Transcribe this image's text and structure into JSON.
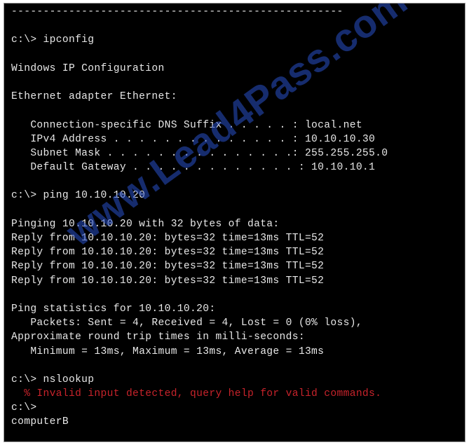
{
  "terminal": {
    "lines": [
      {
        "text": "----------------------------------------------------",
        "type": "normal"
      },
      {
        "text": "",
        "type": "normal"
      },
      {
        "text": "c:\\> ipconfig",
        "type": "normal"
      },
      {
        "text": "",
        "type": "normal"
      },
      {
        "text": "Windows IP Configuration",
        "type": "normal"
      },
      {
        "text": "",
        "type": "normal"
      },
      {
        "text": "Ethernet adapter Ethernet:",
        "type": "normal"
      },
      {
        "text": "",
        "type": "normal"
      },
      {
        "text": "   Connection-specific DNS Suffix . . . . . : local.net",
        "type": "normal"
      },
      {
        "text": "   IPv4 Address . . . . . . . . . . . . . . : 10.10.10.30",
        "type": "normal"
      },
      {
        "text": "   Subnet Mask . . . . . . . . . . . . . . .: 255.255.255.0",
        "type": "normal"
      },
      {
        "text": "   Default Gateway . . . . . . . . . . . . . : 10.10.10.1",
        "type": "normal"
      },
      {
        "text": "",
        "type": "normal"
      },
      {
        "text": "c:\\> ping 10.10.10.20",
        "type": "normal"
      },
      {
        "text": "",
        "type": "normal"
      },
      {
        "text": "Pinging 10.10.10.20 with 32 bytes of data:",
        "type": "normal"
      },
      {
        "text": "Reply from 10.10.10.20: bytes=32 time=13ms TTL=52",
        "type": "normal"
      },
      {
        "text": "Reply from 10.10.10.20: bytes=32 time=13ms TTL=52",
        "type": "normal"
      },
      {
        "text": "Reply from 10.10.10.20: bytes=32 time=13ms TTL=52",
        "type": "normal"
      },
      {
        "text": "Reply from 10.10.10.20: bytes=32 time=13ms TTL=52",
        "type": "normal"
      },
      {
        "text": "",
        "type": "normal"
      },
      {
        "text": "Ping statistics for 10.10.10.20:",
        "type": "normal"
      },
      {
        "text": "   Packets: Sent = 4, Received = 4, Lost = 0 (0% loss),",
        "type": "normal"
      },
      {
        "text": "Approximate round trip times in milli-seconds:",
        "type": "normal"
      },
      {
        "text": "   Minimum = 13ms, Maximum = 13ms, Average = 13ms",
        "type": "normal"
      },
      {
        "text": "",
        "type": "normal"
      },
      {
        "text": "c:\\> nslookup",
        "type": "normal"
      },
      {
        "text": "  % Invalid input detected, query help for valid commands.",
        "type": "error"
      },
      {
        "text": "c:\\>",
        "type": "normal"
      },
      {
        "text": "computerB",
        "type": "normal"
      }
    ]
  },
  "watermark": "www.Lead4Pass.com",
  "colors": {
    "background": "#000000",
    "text": "#e8e8e8",
    "error": "#c8232b",
    "watermark": "#2850c8"
  }
}
